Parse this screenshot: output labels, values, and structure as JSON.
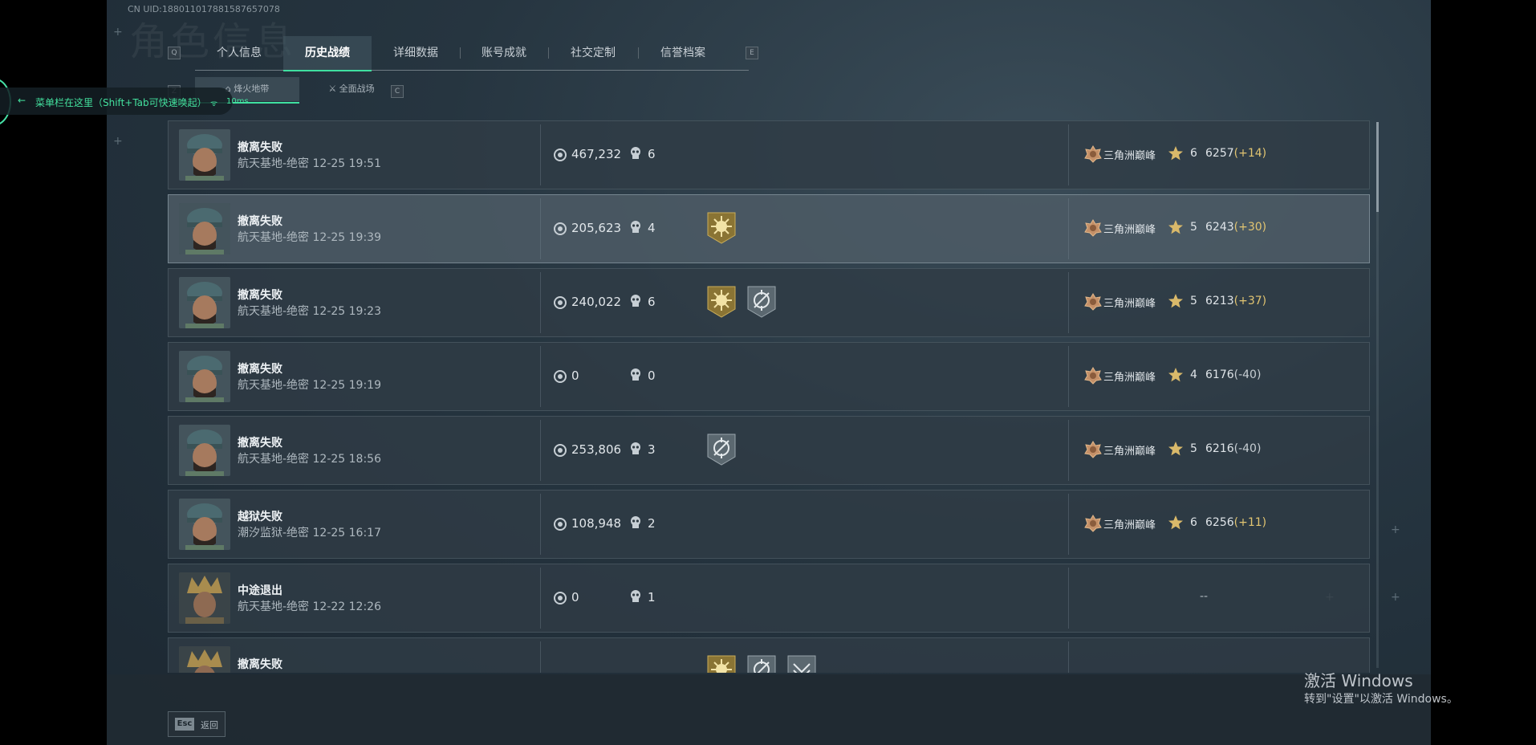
{
  "uid": "CN UID:1880110178815876570​78",
  "background_title": "角色信息",
  "tabs": {
    "left_key": "Q",
    "right_key": "E",
    "items": [
      "个人信息",
      "历史战绩",
      "详细数据",
      "账号成就",
      "社交定制",
      "信誉档案"
    ],
    "active_index": 1
  },
  "subtabs": {
    "left_key": "Z",
    "right_key": "C",
    "items": [
      "烽火地带",
      "全面战场"
    ],
    "active_index": 0
  },
  "hint": {
    "text": "菜单栏在这里（Shift+Tab可快速唤起）",
    "ping": "10ms"
  },
  "matches": [
    {
      "result": "撤离失败",
      "map": "航天基地-绝密 12-25 19:51",
      "value": "467,232",
      "kills": "6",
      "badges": [],
      "rank": "三角洲巅峰",
      "stars": "6",
      "score": "6257",
      "delta": "(+14)",
      "delta_sign": "pos",
      "avatar": "soldier"
    },
    {
      "result": "撤离失败",
      "map": "航天基地-绝密 12-25 19:39",
      "value": "205,623",
      "kills": "4",
      "badges": [
        "gold-burst-badge"
      ],
      "rank": "三角洲巅峰",
      "stars": "5",
      "score": "6243",
      "delta": "(+30)",
      "delta_sign": "pos",
      "avatar": "soldier"
    },
    {
      "result": "撤离失败",
      "map": "航天基地-绝密 12-25 19:23",
      "value": "240,022",
      "kills": "6",
      "badges": [
        "gold-burst-badge",
        "crosshair-badge"
      ],
      "rank": "三角洲巅峰",
      "stars": "5",
      "score": "6213",
      "delta": "(+37)",
      "delta_sign": "pos",
      "avatar": "soldier"
    },
    {
      "result": "撤离失败",
      "map": "航天基地-绝密 12-25 19:19",
      "value": "0",
      "kills": "0",
      "badges": [],
      "rank": "三角洲巅峰",
      "stars": "4",
      "score": "6176",
      "delta": "(-40)",
      "delta_sign": "neg",
      "avatar": "soldier"
    },
    {
      "result": "撤离失败",
      "map": "航天基地-绝密 12-25 18:56",
      "value": "253,806",
      "kills": "3",
      "badges": [
        "crosshair-badge"
      ],
      "rank": "三角洲巅峰",
      "stars": "5",
      "score": "6216",
      "delta": "(-40)",
      "delta_sign": "neg",
      "avatar": "soldier"
    },
    {
      "result": "越狱失败",
      "map": "潮汐监狱-绝密 12-25 16:17",
      "value": "108,948",
      "kills": "2",
      "badges": [],
      "rank": "三角洲巅峰",
      "stars": "6",
      "score": "6256",
      "delta": "(+11)",
      "delta_sign": "pos",
      "avatar": "soldier"
    },
    {
      "result": "中途退出",
      "map": "航天基地-绝密 12-22 12:26",
      "value": "0",
      "kills": "1",
      "badges": [],
      "rank": "",
      "stars": "",
      "score": "",
      "delta": "",
      "delta_sign": "none",
      "placeholder": "--",
      "avatar": "gold"
    },
    {
      "result": "撤离失败",
      "map": "",
      "value": "",
      "kills": "",
      "badges": [
        "gold-burst-badge",
        "crosshair-badge",
        "chevron-badge"
      ],
      "rank": "",
      "stars": "",
      "score": "",
      "delta": "",
      "delta_sign": "none",
      "avatar": "gold"
    }
  ],
  "footer": {
    "esc_key": "Esc",
    "back_label": "返回"
  },
  "windows_activation": {
    "line1": "激活 Windows",
    "line2": "转到\"设置\"以激活 Windows。"
  },
  "colors": {
    "accent": "#3fe0a0",
    "gain": "#e2c571"
  }
}
